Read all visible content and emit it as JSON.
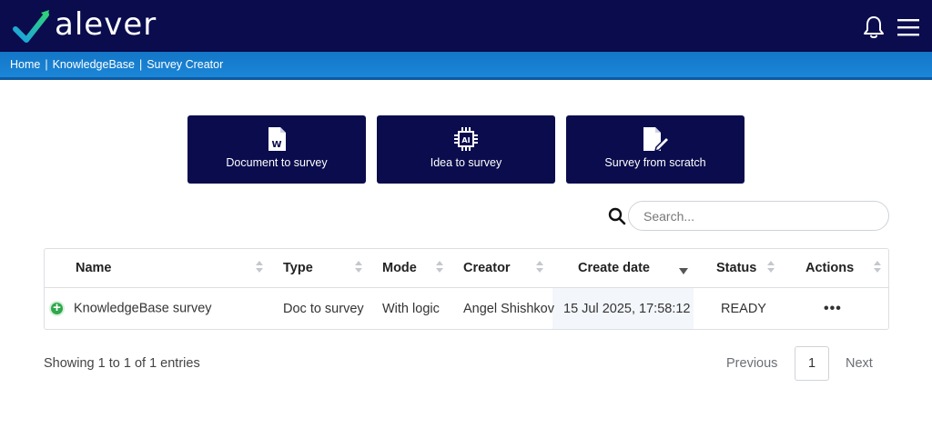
{
  "header": {
    "logo_text": "alever",
    "logo_icon": "check-v-logo",
    "brand_color": "#0a0c4e",
    "accent_color": "#1a7fd2"
  },
  "breadcrumb": [
    "Home",
    "KnowledgeBase",
    "Survey Creator"
  ],
  "cards": [
    {
      "icon": "word-document-icon",
      "label": "Document to survey"
    },
    {
      "icon": "ai-chip-icon",
      "label": "Idea to survey"
    },
    {
      "icon": "edit-document-icon",
      "label": "Survey from scratch"
    }
  ],
  "search": {
    "placeholder": "Search..."
  },
  "table": {
    "columns": [
      "Name",
      "Type",
      "Mode",
      "Creator",
      "Create date",
      "Status",
      "Actions"
    ],
    "sorted_column": "Create date",
    "sort_direction": "desc",
    "rows": [
      {
        "name": "KnowledgeBase survey",
        "type": "Doc to survey",
        "mode": "With logic",
        "creator": "Angel Shishkov",
        "create_date": "15 Jul 2025, 17:58:12",
        "status": "READY",
        "actions": "•••"
      }
    ]
  },
  "footer": {
    "showing": "Showing 1 to 1 of 1 entries",
    "previous": "Previous",
    "page": "1",
    "next": "Next"
  }
}
